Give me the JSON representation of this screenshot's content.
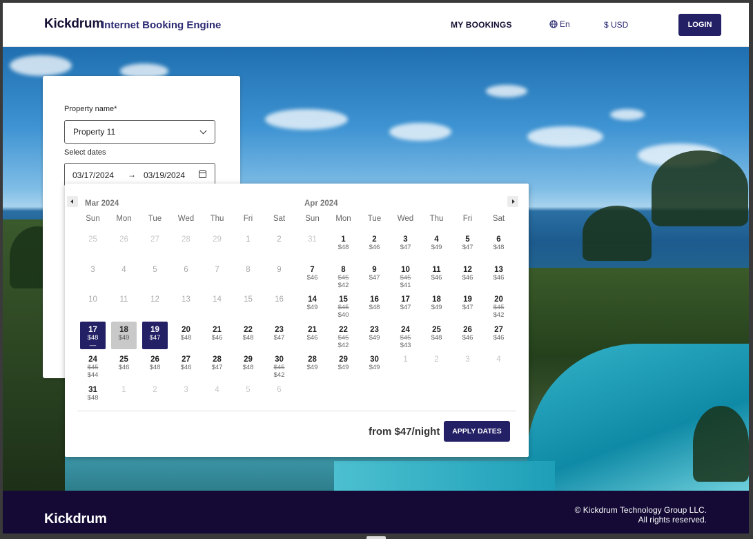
{
  "header": {
    "brand": "Kickdrum",
    "brand_subtitle": "Internet Booking Engine",
    "my_bookings": "MY BOOKINGS",
    "language": "En",
    "currency": "$ USD",
    "login": "LOGIN"
  },
  "search": {
    "property_label": "Property name*",
    "property_value": "Property 11",
    "dates_label": "Select dates",
    "check_in": "03/17/2024",
    "check_out": "03/19/2024",
    "arrow": "→"
  },
  "calendar": {
    "weekdays": [
      "Sun",
      "Mon",
      "Tue",
      "Wed",
      "Thu",
      "Fri",
      "Sat"
    ],
    "months": [
      {
        "title": "Mar 2024",
        "weeks": [
          [
            {
              "d": "25",
              "state": "muted"
            },
            {
              "d": "26",
              "state": "muted"
            },
            {
              "d": "27",
              "state": "muted"
            },
            {
              "d": "28",
              "state": "muted"
            },
            {
              "d": "29",
              "state": "muted"
            },
            {
              "d": "1",
              "state": "dis"
            },
            {
              "d": "2",
              "state": "dis"
            }
          ],
          [
            {
              "d": "3",
              "state": "dis"
            },
            {
              "d": "4",
              "state": "dis"
            },
            {
              "d": "5",
              "state": "dis"
            },
            {
              "d": "6",
              "state": "dis"
            },
            {
              "d": "7",
              "state": "dis"
            },
            {
              "d": "8",
              "state": "dis"
            },
            {
              "d": "9",
              "state": "dis"
            }
          ],
          [
            {
              "d": "10",
              "state": "dis"
            },
            {
              "d": "11",
              "state": "dis"
            },
            {
              "d": "12",
              "state": "dis"
            },
            {
              "d": "13",
              "state": "dis"
            },
            {
              "d": "14",
              "state": "dis"
            },
            {
              "d": "15",
              "state": "dis"
            },
            {
              "d": "16",
              "state": "dis"
            }
          ],
          [
            {
              "d": "17",
              "p": "$48",
              "sub": "—",
              "state": "sel"
            },
            {
              "d": "18",
              "p": "$49",
              "state": "mid"
            },
            {
              "d": "19",
              "p": "$47",
              "state": "sel"
            },
            {
              "d": "20",
              "p": "$48"
            },
            {
              "d": "21",
              "p": "$46"
            },
            {
              "d": "22",
              "p": "$48"
            },
            {
              "d": "23",
              "p": "$47"
            }
          ],
          [
            {
              "d": "24",
              "s": "$45",
              "p": "$44"
            },
            {
              "d": "25",
              "p": "$46"
            },
            {
              "d": "26",
              "p": "$48"
            },
            {
              "d": "27",
              "p": "$46"
            },
            {
              "d": "28",
              "p": "$47"
            },
            {
              "d": "29",
              "p": "$48"
            },
            {
              "d": "30",
              "s": "$45",
              "p": "$42"
            }
          ],
          [
            {
              "d": "31",
              "p": "$48"
            },
            {
              "d": "1",
              "state": "muted"
            },
            {
              "d": "2",
              "state": "muted"
            },
            {
              "d": "3",
              "state": "muted"
            },
            {
              "d": "4",
              "state": "muted"
            },
            {
              "d": "5",
              "state": "muted"
            },
            {
              "d": "6",
              "state": "muted"
            }
          ]
        ]
      },
      {
        "title": "Apr 2024",
        "weeks": [
          [
            {
              "d": "31",
              "state": "muted"
            },
            {
              "d": "1",
              "p": "$48"
            },
            {
              "d": "2",
              "p": "$46"
            },
            {
              "d": "3",
              "p": "$47"
            },
            {
              "d": "4",
              "p": "$49"
            },
            {
              "d": "5",
              "p": "$47"
            },
            {
              "d": "6",
              "p": "$48"
            }
          ],
          [
            {
              "d": "7",
              "p": "$46"
            },
            {
              "d": "8",
              "s": "$45",
              "p": "$42"
            },
            {
              "d": "9",
              "p": "$47"
            },
            {
              "d": "10",
              "s": "$45",
              "p": "$41"
            },
            {
              "d": "11",
              "p": "$46"
            },
            {
              "d": "12",
              "p": "$46"
            },
            {
              "d": "13",
              "p": "$46"
            }
          ],
          [
            {
              "d": "14",
              "p": "$49"
            },
            {
              "d": "15",
              "s": "$45",
              "p": "$40"
            },
            {
              "d": "16",
              "p": "$48"
            },
            {
              "d": "17",
              "p": "$47"
            },
            {
              "d": "18",
              "p": "$49"
            },
            {
              "d": "19",
              "p": "$47"
            },
            {
              "d": "20",
              "s": "$45",
              "p": "$42"
            }
          ],
          [
            {
              "d": "21",
              "p": "$46"
            },
            {
              "d": "22",
              "s": "$45",
              "p": "$42"
            },
            {
              "d": "23",
              "p": "$49"
            },
            {
              "d": "24",
              "s": "$45",
              "p": "$43"
            },
            {
              "d": "25",
              "p": "$48"
            },
            {
              "d": "26",
              "p": "$46"
            },
            {
              "d": "27",
              "p": "$46"
            }
          ],
          [
            {
              "d": "28",
              "p": "$49"
            },
            {
              "d": "29",
              "p": "$49"
            },
            {
              "d": "30",
              "p": "$49"
            },
            {
              "d": "1",
              "state": "muted"
            },
            {
              "d": "2",
              "state": "muted"
            },
            {
              "d": "3",
              "state": "muted"
            },
            {
              "d": "4",
              "state": "muted"
            }
          ]
        ]
      }
    ],
    "from_price": "from $47/night",
    "apply": "APPLY DATES"
  },
  "footer": {
    "logo": "Kickdrum",
    "copyright": "© Kickdrum Technology Group LLC.",
    "rights": "All rights reserved."
  },
  "colors": {
    "primary": "#232066",
    "footer_bg": "#140a35",
    "mid_range": "#c9c9c9"
  }
}
